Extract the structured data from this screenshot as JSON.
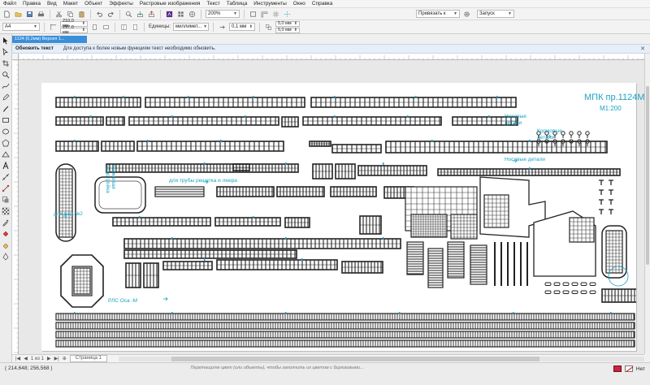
{
  "menu": {
    "items": [
      "Файл",
      "Правка",
      "Вид",
      "Макет",
      "Объект",
      "Эффекты",
      "Растровые изображения",
      "Текст",
      "Таблица",
      "Инструменты",
      "Окно",
      "Справка"
    ]
  },
  "toolbar": {
    "zoom": "200%",
    "snap_label": "Привязать к",
    "launch_label": "Запуск"
  },
  "property_bar": {
    "paper_size": "A4",
    "width": "210,0 мм",
    "height": "297,0 мм",
    "units_label": "Единицы:",
    "units_value": "миллимет...",
    "nudge": "0,1 мм",
    "dup_x": "5,0 мм",
    "dup_y": "5,0 мм"
  },
  "document_tab": {
    "title": "1124 (0,2мм) Версия 1..."
  },
  "info_bar": {
    "action": "Обновить текст",
    "message": "Для доступа к более новым функциям текст необходимо обновить."
  },
  "canvas": {
    "annotations": {
      "title": "МПК пр.1124М",
      "scale": "М1:200",
      "bow_parts_1": "Носовые\nдетали",
      "stern_parts": "Кормовые\nдетали",
      "bow_parts_2": "Носовые детали",
      "stern_vertical": "Кормовая\nнадстройка",
      "pipe_grating": "для трубы решетка и леера",
      "var2": "для вар.№2",
      "rls": "РЛС Оса -М"
    }
  },
  "page_nav": {
    "counter": "1 из 1",
    "page_tab": "Страница 1"
  },
  "status": {
    "coords": "( 214,648; 256,568 )",
    "hint": "Перетащите цвет (или объекты), чтобы заполнить их цветом с бирюзовыми...",
    "fill_none_label": "Нет"
  },
  "colors": {
    "accent": "#1ba3c0",
    "doc_tab": "#3a8fd9",
    "fill_indicator": "#c02a3b"
  }
}
